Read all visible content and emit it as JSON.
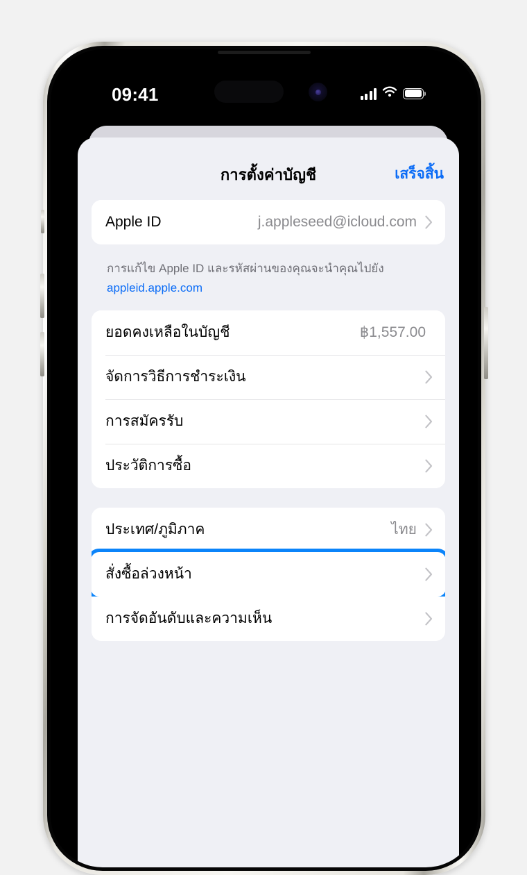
{
  "status_bar": {
    "time": "09:41",
    "signal_icon": "cellular-signal-icon",
    "wifi_icon": "wifi-icon",
    "battery_icon": "battery-icon"
  },
  "nav": {
    "title": "การตั้งค่าบัญชี",
    "done_label": "เสร็จสิ้น"
  },
  "account_group": {
    "apple_id": {
      "label": "Apple ID",
      "value": "j.appleseed@icloud.com"
    }
  },
  "footnote": {
    "text": "การแก้ไข Apple ID และรหัสผ่านของคุณจะนำคุณไปยัง",
    "link": "appleid.apple.com"
  },
  "billing_group": {
    "rows": [
      {
        "label": "ยอดคงเหลือในบัญชี",
        "value": "฿1,557.00",
        "chevron": false
      },
      {
        "label": "จัดการวิธีการชำระเงิน",
        "value": "",
        "chevron": true
      },
      {
        "label": "การสมัครรับ",
        "value": "",
        "chevron": true
      },
      {
        "label": "ประวัติการซื้อ",
        "value": "",
        "chevron": true
      }
    ]
  },
  "region_group": {
    "rows": [
      {
        "label": "ประเทศ/ภูมิภาค",
        "value": "ไทย",
        "chevron": true
      },
      {
        "label": "สั่งซื้อล่วงหน้า",
        "value": "",
        "chevron": true,
        "highlighted": true
      },
      {
        "label": "การจัดอันดับและความเห็น",
        "value": "",
        "chevron": true
      }
    ]
  },
  "colors": {
    "accent_blue": "#0b6cf6",
    "highlight_blue": "#0b84fa",
    "sheet_background": "#eff0f5",
    "row_background": "#ffffff",
    "secondary_text": "#8a8a8e",
    "page_background": "#f2f2f2"
  }
}
